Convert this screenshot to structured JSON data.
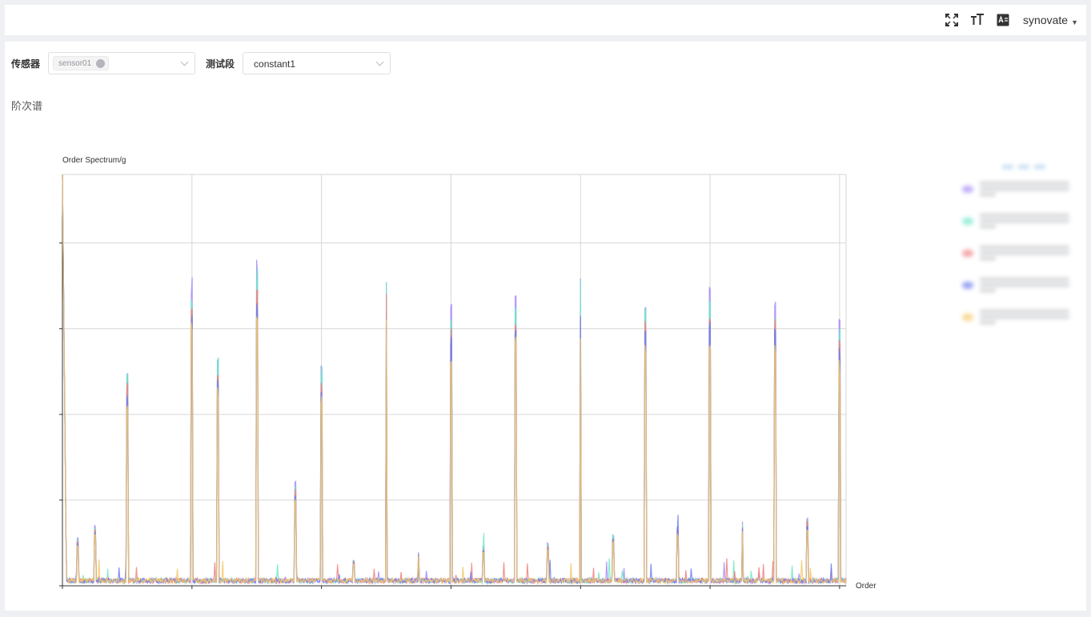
{
  "header": {
    "user_name": "synovate",
    "icons": [
      "fullscreen-icon",
      "font-size-icon",
      "text-format-icon"
    ]
  },
  "filters": {
    "sensor_label": "传感器",
    "sensor_tag": "sensor01",
    "segment_label": "测试段",
    "segment_value": "constant1"
  },
  "section_title": "阶次谱",
  "chart_data": {
    "type": "line",
    "ylabel": "Order Spectrum/g",
    "xlabel": "Order",
    "grid": true,
    "legend_position": "right",
    "series": [
      {
        "color": "#a78bfa"
      },
      {
        "color": "#6ee7c8"
      },
      {
        "color": "#f08080"
      },
      {
        "color": "#6b7df0"
      },
      {
        "color": "#f5c767"
      }
    ],
    "peaks": [
      {
        "x": 1,
        "y": 0.5
      },
      {
        "x": 2,
        "y": 0.7
      },
      {
        "x": 2.4,
        "y": 0.54
      },
      {
        "x": 3,
        "y": 0.75
      },
      {
        "x": 3.6,
        "y": 0.24
      },
      {
        "x": 4,
        "y": 0.51
      },
      {
        "x": 5,
        "y": 0.72
      },
      {
        "x": 6,
        "y": 0.64
      },
      {
        "x": 7,
        "y": 0.67
      },
      {
        "x": 8,
        "y": 0.7
      },
      {
        "x": 9,
        "y": 0.66
      },
      {
        "x": 10,
        "y": 0.68
      },
      {
        "x": 11,
        "y": 0.66
      },
      {
        "x": 12,
        "y": 0.61
      }
    ],
    "minor_peaks": [
      {
        "x": 0.23,
        "y": 0.11
      },
      {
        "x": 0.5,
        "y": 0.14
      },
      {
        "x": 4.5,
        "y": 0.06
      },
      {
        "x": 5.5,
        "y": 0.08
      },
      {
        "x": 6.5,
        "y": 0.09
      },
      {
        "x": 7.5,
        "y": 0.1
      },
      {
        "x": 8.5,
        "y": 0.12
      },
      {
        "x": 9.5,
        "y": 0.14
      },
      {
        "x": 10.5,
        "y": 0.15
      },
      {
        "x": 11.5,
        "y": 0.16
      }
    ],
    "xlim": [
      0,
      12.1
    ],
    "ylim": [
      0,
      0.96
    ]
  }
}
